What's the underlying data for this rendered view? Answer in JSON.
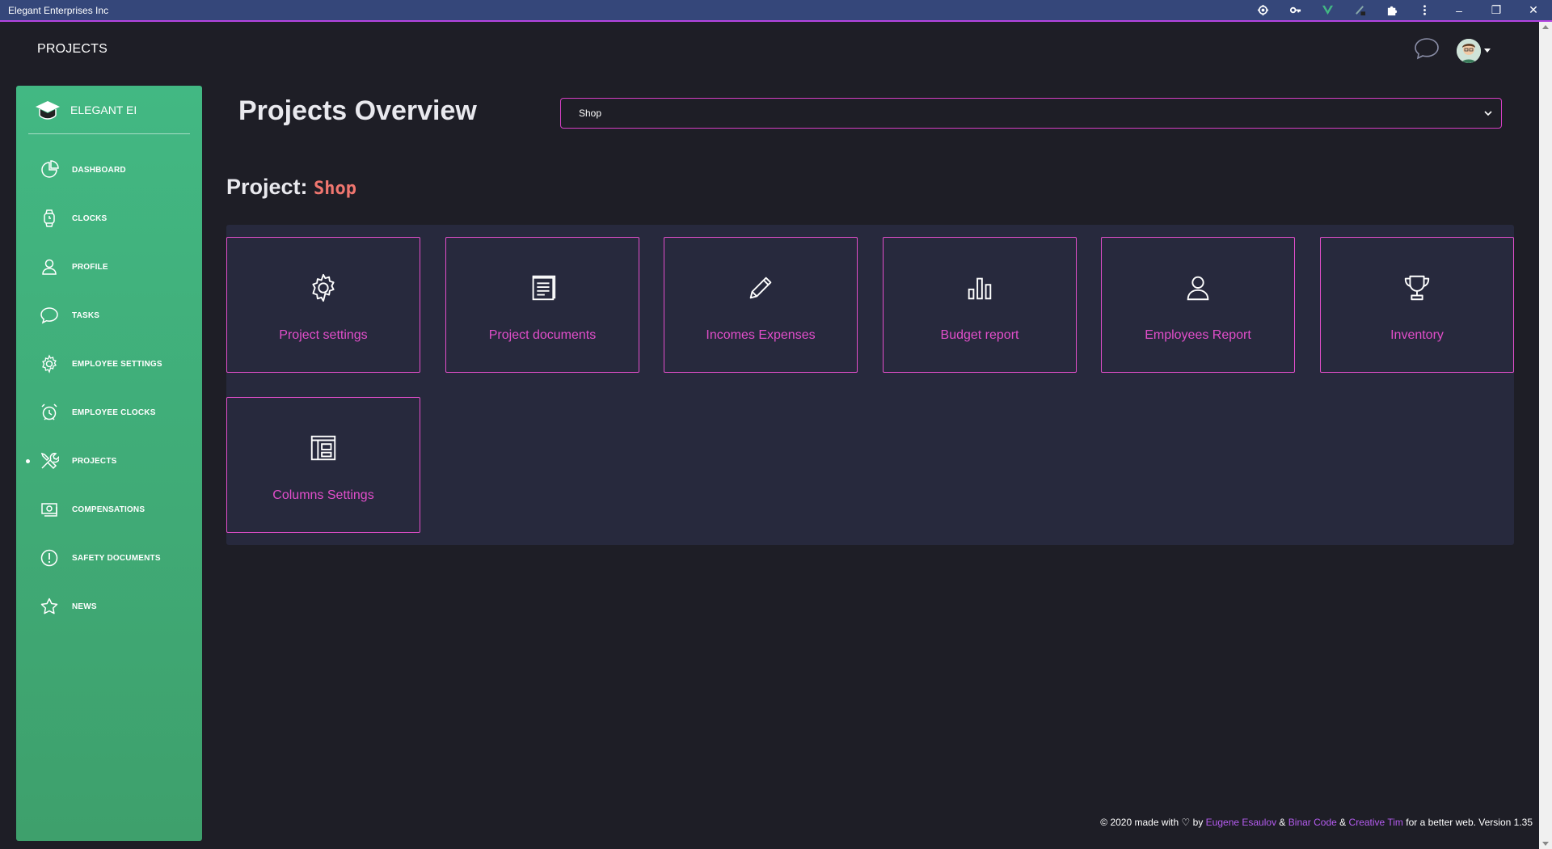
{
  "window": {
    "title": "Elegant Enterprises Inc",
    "controls": {
      "minimize": "–",
      "restore": "❐",
      "close": "✕"
    },
    "extension_icons": [
      "location-icon",
      "key-icon",
      "vue-icon",
      "pen-icon",
      "puzzle-icon",
      "kebab-menu-icon"
    ]
  },
  "navbar": {
    "brand": "PROJECTS"
  },
  "sidebar": {
    "logo_text": "ELEGANT EI",
    "items": [
      {
        "label": "DASHBOARD",
        "icon": "pie-chart-icon"
      },
      {
        "label": "CLOCKS",
        "icon": "watch-icon"
      },
      {
        "label": "PROFILE",
        "icon": "user-icon"
      },
      {
        "label": "TASKS",
        "icon": "chat-bubble-icon"
      },
      {
        "label": "EMPLOYEE SETTINGS",
        "icon": "gear-icon"
      },
      {
        "label": "EMPLOYEE CLOCKS",
        "icon": "alarm-clock-icon"
      },
      {
        "label": "PROJECTS",
        "icon": "tools-icon",
        "active": true
      },
      {
        "label": "COMPENSATIONS",
        "icon": "money-icon"
      },
      {
        "label": "SAFETY DOCUMENTS",
        "icon": "alert-circle-icon"
      },
      {
        "label": "NEWS",
        "icon": "star-icon"
      }
    ]
  },
  "main": {
    "title": "Projects Overview",
    "select": {
      "value": "Shop"
    },
    "project_label": "Project:",
    "project_name": "Shop",
    "cards": [
      {
        "label": "Project settings",
        "icon": "gear-icon"
      },
      {
        "label": "Project documents",
        "icon": "document-icon"
      },
      {
        "label": "Incomes Expenses",
        "icon": "pencil-icon"
      },
      {
        "label": "Budget report",
        "icon": "bar-chart-icon"
      },
      {
        "label": "Employees Report",
        "icon": "user-icon"
      },
      {
        "label": "Inventory",
        "icon": "trophy-icon"
      },
      {
        "label": "Columns Settings",
        "icon": "columns-layout-icon"
      }
    ]
  },
  "footer": {
    "prefix": "© 2020 made with",
    "by": "by",
    "author": "Eugene Esaulov",
    "amp1": "&",
    "company": "Binar Code",
    "amp2": "&",
    "creative": "Creative Tim",
    "suffix": "for a better web. Version 1.35"
  },
  "colors": {
    "accent": "#e14eca",
    "sidebar_green": "#42b883",
    "background": "#1e1e26",
    "panel": "#27293d",
    "project_name": "#f0766f",
    "titlebar": "#35477a"
  }
}
